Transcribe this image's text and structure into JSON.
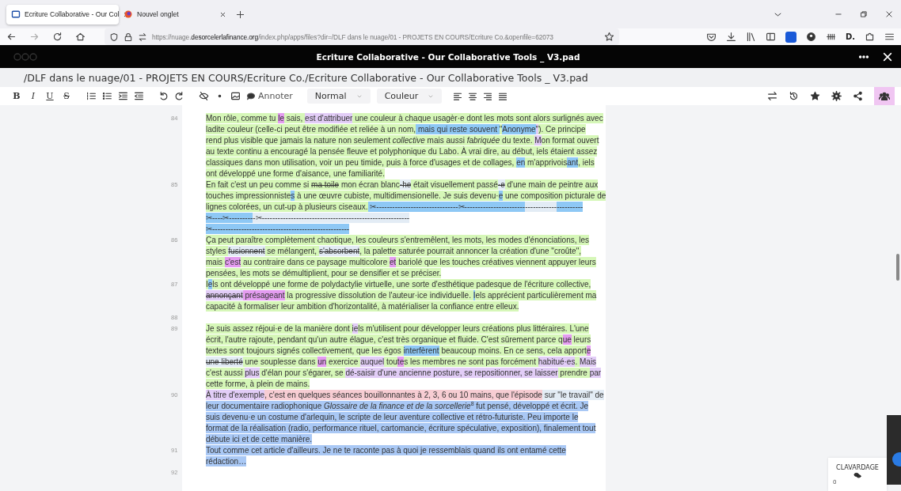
{
  "browser": {
    "tabs": [
      {
        "title": "Ecriture Collaborative - Our Col",
        "selected": true,
        "kind": "doc"
      },
      {
        "title": "Nouvel onglet",
        "selected": false,
        "kind": "firefox"
      }
    ],
    "url": {
      "scheme": "https://nuage.",
      "host": "desorcelerlafinance.org",
      "path": "/index.php/apps/files?dir=/DLF dans le nuage/01 - PROJETS EN COURS/Ecriture Co.&openfile=62073"
    },
    "extension_label": "D."
  },
  "app_header": {
    "title": "Ecriture Collaborative - Our Collaborative Tools _ V3.pad"
  },
  "path": "/DLF dans le nuage/01 - PROJETS EN COURS/Ecriture Co./Ecriture Collaborative - Our Collaborative Tools _ V3.pad",
  "toolbar": {
    "format_buttons": [
      "B",
      "I",
      "U",
      "S"
    ],
    "comment_label": "Annoter",
    "style_dropdown": "Normal",
    "color_dropdown": "Couleur",
    "users_selected": true
  },
  "editor": {
    "paragraphs": [
      {
        "line_number": "84",
        "lines": [
          {
            "segments": [
              {
                "text": "Mon rôle, comme tu ",
                "color": "#d6f7b8",
                "kind": "text"
              },
              {
                "text": "le",
                "color": "#e49cf0",
                "kind": "text"
              },
              {
                "text": " sais, ",
                "color": "#d6f7b8",
                "kind": "text"
              },
              {
                "text": "est d'attribuer",
                "color": "#e2cdf7",
                "kind": "text"
              },
              {
                "text": " une couleur à chaque usagèr·e dont les mots sont alors surlignés avec",
                "color": "#d6f7b8",
                "kind": "text"
              }
            ]
          },
          {
            "segments": [
              {
                "text": "ladite couleur (celle-ci peut être modifiée et reliée à un nom,",
                "color": "#d6f7b8",
                "kind": "text"
              },
              {
                "text": " mais qui reste souvent ",
                "color": "#8ec8f5",
                "kind": "text"
              },
              {
                "text": "\"",
                "color": "#d6f7b8",
                "kind": "text"
              },
              {
                "text": "Anonyme",
                "color": "#8ec8f5",
                "kind": "text"
              },
              {
                "text": "\"",
                "color": "#e2cdf7",
                "kind": "text"
              },
              {
                "text": "). Ce principe",
                "color": "#d6f7b8",
                "kind": "text"
              }
            ]
          },
          {
            "segments": [
              {
                "text": "rend plus visible que jamais la nature non seulement ",
                "color": "#d6f7b8",
                "kind": "text"
              },
              {
                "text": "collective",
                "color": "#d6f7b8",
                "kind": "italic"
              },
              {
                "text": " mais aussi ",
                "color": "#d6f7b8",
                "kind": "text"
              },
              {
                "text": "fabriquée",
                "color": "#d6f7b8",
                "kind": "italic"
              },
              {
                "text": " du texte. ",
                "color": "#d6f7b8",
                "kind": "text"
              },
              {
                "text": "M",
                "color": "#e2cdf7",
                "kind": "text"
              },
              {
                "text": "on format ouvert",
                "color": "#d6f7b8",
                "kind": "text"
              }
            ]
          },
          {
            "segments": [
              {
                "text": "au texte continu a encouragé la pensée fleuve et polyphonique du Labo. À vrai dire, au début, iels étaient assez",
                "color": "#d6f7b8",
                "kind": "text"
              }
            ]
          },
          {
            "segments": [
              {
                "text": "classiques dans mon utilisation, voir un peu timide, puis à force d'usages et de collages, ",
                "color": "#d6f7b8",
                "kind": "text"
              },
              {
                "text": "en",
                "color": "#8ec8f5",
                "kind": "text"
              },
              {
                "text": " m'apprivois",
                "color": "#d6f7b8",
                "kind": "text"
              },
              {
                "text": "ant",
                "color": "#8ec8f5",
                "kind": "text"
              },
              {
                "text": ", iels",
                "color": "#d6f7b8",
                "kind": "text"
              }
            ]
          },
          {
            "segments": [
              {
                "text": "ont développé une forme d'aisance, une familiarité.",
                "color": "#d6f7b8",
                "kind": "text"
              }
            ]
          }
        ]
      },
      {
        "line_number": "85",
        "lines": [
          {
            "segments": [
              {
                "text": "En fait c'est un peu comme si ",
                "color": "#d6f7b8",
                "kind": "text"
              },
              {
                "text": "ma toile",
                "color": "#d6f7b8",
                "kind": "deleted"
              },
              {
                "text": " mon écran blanc",
                "color": "#d6f7b8",
                "kind": "text"
              },
              {
                "text": "·he",
                "color": "#e3ecf5",
                "kind": "deleted"
              },
              {
                "text": " était visuellement passé",
                "color": "#d6f7b8",
                "kind": "text"
              },
              {
                "text": "·e",
                "color": "#e3ecf5",
                "kind": "deleted"
              },
              {
                "text": " d'une main de peintre aux",
                "color": "#d6f7b8",
                "kind": "text"
              }
            ]
          },
          {
            "segments": [
              {
                "text": "touches impressionniste",
                "color": "#d6f7b8",
                "kind": "text"
              },
              {
                "text": "s",
                "color": "#8ec8f5",
                "kind": "text"
              },
              {
                "text": " à une œuvre cubiste, multidimensionelle. Je suis devenu·",
                "color": "#d6f7b8",
                "kind": "text"
              },
              {
                "text": "e",
                "color": "#8ec8f5",
                "kind": "text"
              },
              {
                "text": " une composition picturale de",
                "color": "#d6f7b8",
                "kind": "text"
              }
            ]
          },
          {
            "segments": [
              {
                "text": "lignes colorées, un cut-up à plusieurs ciseaux.",
                "color": "#d6f7b8",
                "kind": "text"
              },
              {
                "text": " ✂-------------------------------✂-----------------------",
                "color": "#8ec8f5",
                "kind": "text"
              },
              {
                "text": "------------",
                "color": "#e3ecf5",
                "kind": "text"
              },
              {
                "text": "----------",
                "color": "#8ec8f5",
                "kind": "text"
              }
            ]
          },
          {
            "segments": [
              {
                "text": "✂----✂---------",
                "color": "#8ec8f5",
                "kind": "text"
              },
              {
                "text": "-✂--------------------------------------------------------",
                "color": "#e3ecf5",
                "kind": "text"
              }
            ]
          },
          {
            "segments": [
              {
                "text": "✂----------------------------------------------------",
                "color": "#8ec8f5",
                "kind": "text"
              }
            ]
          }
        ]
      },
      {
        "line_number": "86",
        "lines": [
          {
            "segments": [
              {
                "text": "Ça peut paraître complètement chaotique, les couleurs s'entremêlent, les mots, les modes d'énonciations, les",
                "color": "#d6f7b8",
                "kind": "text"
              }
            ]
          },
          {
            "segments": [
              {
                "text": "styles ",
                "color": "#d6f7b8",
                "kind": "text"
              },
              {
                "text": "fusionnent",
                "color": "#e3ecf5",
                "kind": "deleted"
              },
              {
                "text": " se mélangent, ",
                "color": "#d6f7b8",
                "kind": "text"
              },
              {
                "text": "s'absorbent",
                "color": "#e3ecf5",
                "kind": "deleted"
              },
              {
                "text": ", la palette saturée pourrait annoncer la création d'une \"croûte\",",
                "color": "#d6f7b8",
                "kind": "text"
              }
            ]
          },
          {
            "segments": [
              {
                "text": "mais ",
                "color": "#d6f7b8",
                "kind": "text"
              },
              {
                "text": "c'est",
                "color": "#e49cf0",
                "kind": "text"
              },
              {
                "text": " au contraire dans ce paysage multicolore ",
                "color": "#d6f7b8",
                "kind": "text"
              },
              {
                "text": "et",
                "color": "#e49cf0",
                "kind": "text"
              },
              {
                "text": " bariolé que les touches créatives viennent appuyer leurs",
                "color": "#d6f7b8",
                "kind": "text"
              }
            ]
          },
          {
            "segments": [
              {
                "text": "pensées, les mots se démultiplient, pour se densifier et se préciser.",
                "color": "#d6f7b8",
                "kind": "text"
              }
            ]
          }
        ]
      },
      {
        "line_number": "87",
        "lines": [
          {
            "segments": [
              {
                "text": "I",
                "color": "#d6f7b8",
                "kind": "text"
              },
              {
                "text": "e",
                "color": "#8ec8f5",
                "kind": "text"
              },
              {
                "text": "ls ont développé une forme de polydactylie virtuelle, une sorte d'esthétique padesque de l'écriture collective,",
                "color": "#d6f7b8",
                "kind": "text"
              }
            ]
          },
          {
            "segments": [
              {
                "text": "annonçant",
                "color": "#e2cdf7",
                "kind": "deleted"
              },
              {
                "text": " présageant",
                "color": "#e49cf0",
                "kind": "text"
              },
              {
                "text": " la progressive dissolution de l'auteur·ice individuelle. ",
                "color": "#d6f7b8",
                "kind": "text"
              },
              {
                "text": "I",
                "color": "#8ec8f5",
                "kind": "text"
              },
              {
                "text": "els apprécient particulièrement ma",
                "color": "#d6f7b8",
                "kind": "text"
              }
            ]
          },
          {
            "segments": [
              {
                "text": "capacité à formaliser leur ambition d'horizontalité, à matérialiser la confiance entre elleux.",
                "color": "#d6f7b8",
                "kind": "text"
              }
            ]
          }
        ]
      },
      {
        "line_number": "88"
      },
      {
        "line_number": "89",
        "lines": [
          {
            "segments": [
              {
                "text": "Je suis assez réjoui·e de la manière dont ",
                "color": "#d6f7b8",
                "kind": "text"
              },
              {
                "text": "ie",
                "color": "#e2cdf7",
                "kind": "text"
              },
              {
                "text": "ls m'utilisent pour développer leurs créations plus littéraires. L'une",
                "color": "#d6f7b8",
                "kind": "text"
              }
            ]
          },
          {
            "segments": [
              {
                "text": "écrit, l'autre rajoute, pendant qu'un autre élague, c'est très organique et fluide. C'est sûrement parce q",
                "color": "#d6f7b8",
                "kind": "text"
              },
              {
                "text": "ue",
                "color": "#e49cf0",
                "kind": "text"
              },
              {
                "text": " leurs",
                "color": "#d6f7b8",
                "kind": "text"
              }
            ]
          },
          {
            "segments": [
              {
                "text": "textes sont toujours signés collectivement, que les égos ",
                "color": "#d6f7b8",
                "kind": "text"
              },
              {
                "text": "interfèrent",
                "color": "#8ec8f5",
                "kind": "text"
              },
              {
                "text": " beaucoup moins. En ce sens, cela apport",
                "color": "#d6f7b8",
                "kind": "text"
              },
              {
                "text": "e",
                "color": "#e49cf0",
                "kind": "text"
              }
            ]
          },
          {
            "segments": [
              {
                "text": "une liberté",
                "color": "#e3ecf5",
                "kind": "deleted"
              },
              {
                "text": " une souplesse dans ",
                "color": "#d6f7b8",
                "kind": "text"
              },
              {
                "text": "un",
                "color": "#e49cf0",
                "kind": "text"
              },
              {
                "text": " exercice ",
                "color": "#d6f7b8",
                "kind": "text"
              },
              {
                "text": "auquel",
                "color": "#e2cdf7",
                "kind": "text"
              },
              {
                "text": " tou",
                "color": "#d6f7b8",
                "kind": "text"
              },
              {
                "text": "te",
                "color": "#e49cf0",
                "kind": "text"
              },
              {
                "text": "s les membres ne sont pas forcément ",
                "color": "#d6f7b8",
                "kind": "text"
              },
              {
                "text": "habitué·es",
                "color": "#e2cdf7",
                "kind": "text"
              },
              {
                "text": ". ",
                "color": "#d6f7b8",
                "kind": "text"
              },
              {
                "text": "Mais",
                "color": "#e2cdf7",
                "kind": "text"
              }
            ]
          },
          {
            "segments": [
              {
                "text": "c'est aussi ",
                "color": "#d6f7b8",
                "kind": "text"
              },
              {
                "text": "plus",
                "color": "#e2cdf7",
                "kind": "text"
              },
              {
                "text": " d'élan pour s'égarer, se ",
                "color": "#d6f7b8",
                "kind": "text"
              },
              {
                "text": "dé-saisir d'une ancienne posture, se repositionner, se laisser",
                "color": "#e2cdf7",
                "kind": "text"
              },
              {
                "text": " prendre ",
                "color": "#d6f7b8",
                "kind": "text"
              },
              {
                "text": "par",
                "color": "#e2cdf7",
                "kind": "text"
              }
            ]
          },
          {
            "segments": [
              {
                "text": "cette forme, à plein de mains.",
                "color": "#d6f7b8",
                "kind": "text"
              }
            ]
          }
        ]
      },
      {
        "line_number": "90",
        "lines": [
          {
            "segments": [
              {
                "text": "À titre d'exemple",
                "color": "#e2cdf7",
                "kind": "text"
              },
              {
                "text": ", c'est en quelques séances bouillonnantes à 2, 3, 6 ou 10 mains, que l'épisode",
                "color": "#f7cdd3",
                "kind": "text"
              },
              {
                "text": " sur \"le travail\" de",
                "color": "#e3ecf5",
                "kind": "text"
              }
            ]
          },
          {
            "segments": [
              {
                "text": "leur documentaire radiophonique ",
                "color": "#a9c8f5",
                "kind": "text"
              },
              {
                "text": "Glossaire de la finance et de la sorcellerie",
                "color": "#a9c8f5",
                "kind": "italic"
              },
              {
                "text": "8",
                "color": "#a9c8f5",
                "kind": "sup"
              },
              {
                "text": " fut pensé, développé et écrit. Je",
                "color": "#a9c8f5",
                "kind": "text"
              }
            ]
          },
          {
            "segments": [
              {
                "text": "suis devenu·e un costume d'arlequin, le scripte de leur aventure collective et rétro-futuriste. Peu importe le",
                "color": "#a9c8f5",
                "kind": "text"
              }
            ]
          },
          {
            "segments": [
              {
                "text": "format de la réalisation (radio, performance rituel, cartomancie, écriture spéculative, exposition), finalement tout",
                "color": "#a9c8f5",
                "kind": "text"
              }
            ]
          },
          {
            "segments": [
              {
                "text": "débute ici et de cette manière.",
                "color": "#a9c8f5",
                "kind": "text"
              }
            ]
          }
        ]
      },
      {
        "line_number": "91",
        "lines": [
          {
            "segments": [
              {
                "text": "Tout comme cet article d'ailleurs. Je ne te raconte pas à quoi je ressemblais quand ils ont entamé cette",
                "color": "#a9c8f5",
                "kind": "text"
              }
            ]
          },
          {
            "segments": [
              {
                "text": "rédaction…",
                "color": "#a9c8f5",
                "kind": "text"
              }
            ]
          }
        ]
      },
      {
        "line_number": "92"
      }
    ]
  },
  "chat": {
    "label": "CLAVARDAGE",
    "count": "0"
  }
}
